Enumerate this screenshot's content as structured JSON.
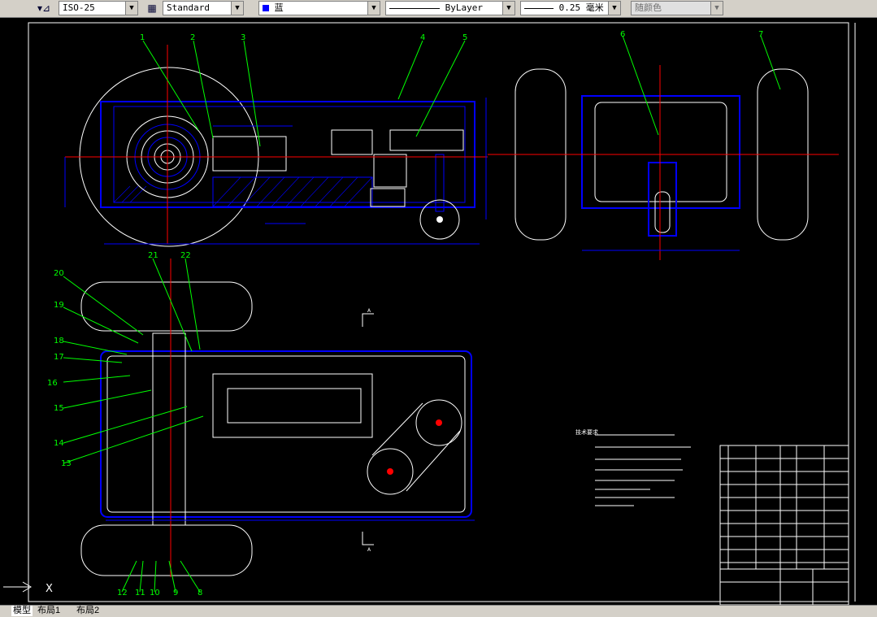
{
  "toolbar": {
    "dimstyle_value": "ISO-25",
    "tablestyle_value": "Standard",
    "color_value": "蓝",
    "color_swatch": "#0000ff",
    "linetype_value": "ByLayer",
    "lineweight_value": "0.25 毫米",
    "plotstyle_value": "随颜色"
  },
  "drawing": {
    "callouts": [
      "1",
      "2",
      "3",
      "4",
      "5",
      "6",
      "7",
      "8",
      "9",
      "10",
      "11",
      "12",
      "13",
      "14",
      "15",
      "16",
      "17",
      "18",
      "19",
      "20",
      "21",
      "22"
    ],
    "section_mark": "A",
    "ucs_axis": "X",
    "notes_label": "技术要求"
  },
  "layout_tabs": [
    "模型",
    "布局1",
    "布局2"
  ],
  "colors": {
    "background": "#000000",
    "outline": "#ffffff",
    "part": "#0000ff",
    "leader": "#00ff00",
    "center": "#ff0000",
    "dim": "#0000ff"
  }
}
